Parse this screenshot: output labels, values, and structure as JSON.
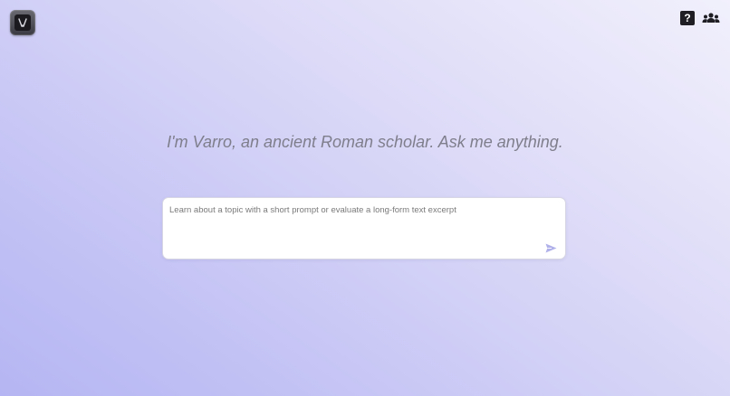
{
  "header": {
    "logo_icon": "varro-logo-icon",
    "help_icon_glyph": "?",
    "help_icon": "help-icon",
    "group_icon": "group-icon"
  },
  "main": {
    "tagline": "I'm Varro, an ancient Roman scholar. Ask me anything.",
    "prompt_placeholder": "Learn about a topic with a short prompt or evaluate a long-form text excerpt",
    "prompt_value": "",
    "send_icon": "send-icon"
  },
  "colors": {
    "background_top": "#f1f0fc",
    "background_bottom": "#b5b5f3",
    "tagline_text": "#7e7e8c",
    "send_icon": "#b0b0ea",
    "icon_dark": "#1e1e24"
  }
}
